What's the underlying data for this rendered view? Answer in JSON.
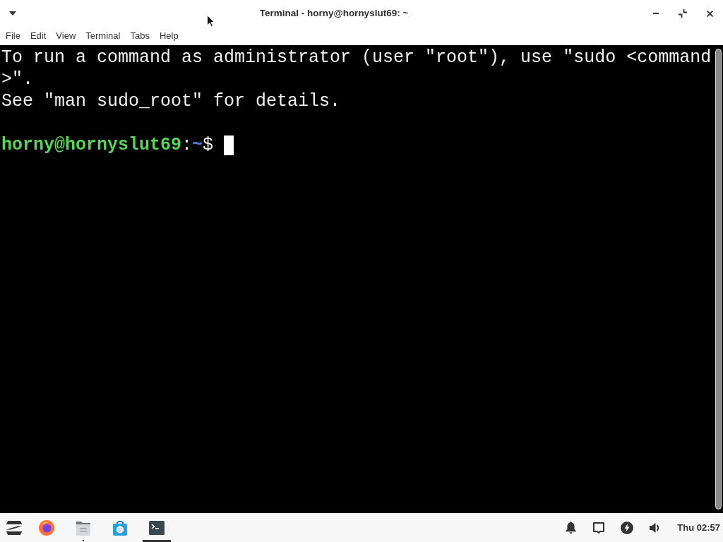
{
  "window": {
    "title": "Terminal - horny@hornyslut69: ~"
  },
  "menu": [
    "File",
    "Edit",
    "View",
    "Terminal",
    "Tabs",
    "Help"
  ],
  "terminal": {
    "output_lines": [
      "To run a command as administrator (user \"root\"), use \"sudo <command",
      ">\".",
      "See \"man sudo_root\" for details."
    ],
    "prompt": {
      "user_host": "horny@hornyslut69",
      "separator": ":",
      "path": "~",
      "symbol": "$"
    }
  },
  "taskbar": {
    "apps": [
      {
        "kind": "menu",
        "running": false,
        "focused": false
      },
      {
        "kind": "browser",
        "running": false,
        "focused": false
      },
      {
        "kind": "files",
        "running": true,
        "focused": false
      },
      {
        "kind": "store",
        "running": false,
        "focused": false
      },
      {
        "kind": "terminal",
        "running": false,
        "focused": true
      }
    ],
    "tray": [
      {
        "kind": "notifications"
      },
      {
        "kind": "display"
      },
      {
        "kind": "power"
      },
      {
        "kind": "volume"
      }
    ],
    "clock": "Thu 02:57"
  }
}
